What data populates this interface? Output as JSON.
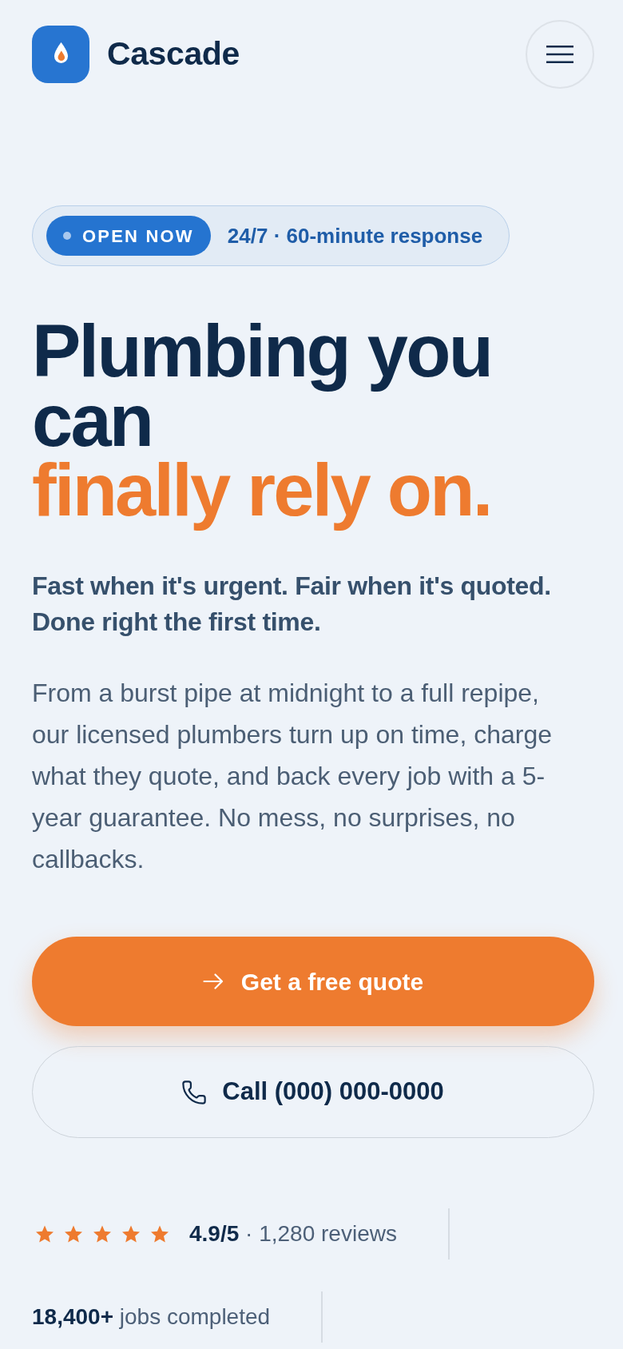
{
  "header": {
    "brand": "Cascade"
  },
  "badge": {
    "status": "OPEN NOW",
    "text": "24/7 · 60-minute response"
  },
  "headline": {
    "main": "Plumbing you can",
    "accent": "finally rely on."
  },
  "subheadline": "Fast when it's urgent. Fair when it's quoted. Done right the first time.",
  "description": "From a burst pipe at midnight to a full repipe, our licensed plumbers turn up on time, charge what they quote, and back every job with a 5-year guarantee. No mess, no surprises, no callbacks.",
  "buttons": [
    {
      "kind": "primary",
      "label": "Get a free quote"
    },
    {
      "kind": "secondary",
      "label": "Call (000) 000-0000"
    }
  ],
  "stats": [
    {
      "kind": "rating",
      "stars": 5,
      "text": "**4.9/5** · 1,280 reviews"
    },
    {
      "kind": "count",
      "text": "**18,400+** jobs completed"
    }
  ]
}
